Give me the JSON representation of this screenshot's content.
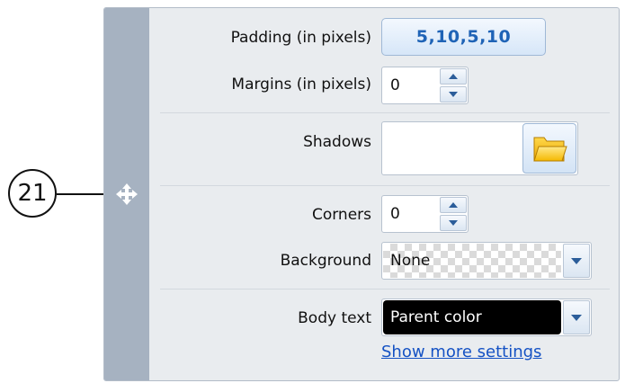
{
  "callout": {
    "number": "21"
  },
  "fields": {
    "padding": {
      "label": "Padding (in pixels)",
      "value": "5,10,5,10"
    },
    "margins": {
      "label": "Margins (in pixels)",
      "value": "0"
    },
    "shadows": {
      "label": "Shadows"
    },
    "corners": {
      "label": "Corners",
      "value": "0"
    },
    "background": {
      "label": "Background",
      "value": "None"
    },
    "body_text": {
      "label": "Body text",
      "value": "Parent color"
    }
  },
  "link": {
    "label": "Show more settings"
  },
  "icons": {
    "handle": "move-icon",
    "folder": "folder-icon",
    "spin_up": "chevron-up-icon",
    "spin_down": "chevron-down-icon",
    "dropdown": "chevron-down-icon"
  },
  "colors": {
    "panel_bg": "#e9ecef",
    "handle_bg": "#a6b2c1",
    "button_text": "#1f63b6",
    "link": "#1552c4",
    "body_text_swatch": "#000000"
  }
}
